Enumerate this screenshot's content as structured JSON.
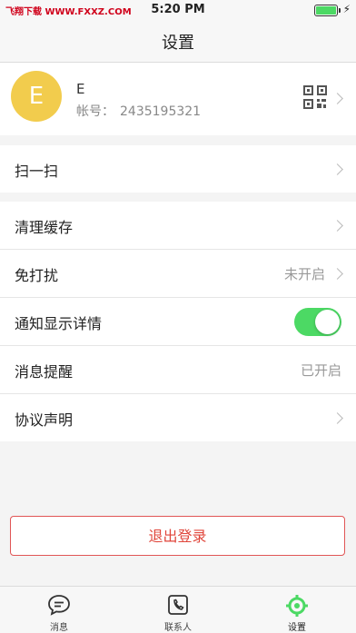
{
  "status_bar": {
    "carrier": "飞翔下载 WWW.FXXZ.COM",
    "time": "5:20 PM",
    "battery_level": 1.0
  },
  "navbar": {
    "title": "设置"
  },
  "profile": {
    "avatar_letter": "E",
    "name": "E",
    "account_label": "帐号：",
    "account_number": "2435195321",
    "qr_icon": "qr-code-icon"
  },
  "rows": {
    "scan": {
      "label": "扫一扫"
    },
    "clear_cache": {
      "label": "清理缓存"
    },
    "dnd": {
      "label": "免打扰",
      "value": "未开启"
    },
    "notify_detail": {
      "label": "通知显示详情",
      "toggle_on": true
    },
    "message_alert": {
      "label": "消息提醒",
      "value": "已开启"
    },
    "agreement": {
      "label": "协议声明"
    }
  },
  "logout_button": "退出登录",
  "tabs": [
    {
      "label": "消息",
      "icon": "chat-bubble-icon",
      "active": false
    },
    {
      "label": "联系人",
      "icon": "contacts-phone-icon",
      "active": false
    },
    {
      "label": "设置",
      "icon": "settings-icon",
      "active": true
    }
  ],
  "colors": {
    "accent_green": "#4cd964",
    "avatar_yellow": "#f2cc4d",
    "logout_red": "#e0463b"
  }
}
